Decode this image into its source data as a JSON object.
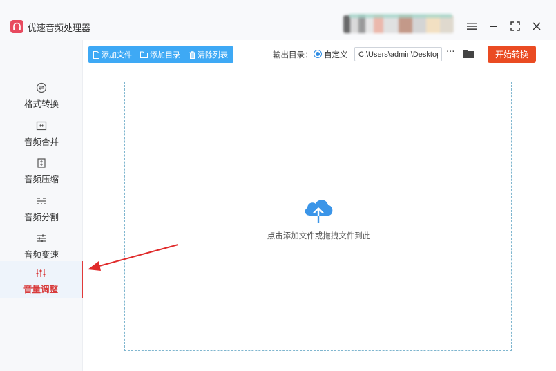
{
  "app": {
    "title": "优速音频处理器"
  },
  "window_controls": {
    "menu_icon": "hamburger-icon",
    "minimize_icon": "minimize-icon",
    "maximize_icon": "maximize-icon",
    "close_icon": "close-icon"
  },
  "sidebar": {
    "items": [
      {
        "label": "格式转换",
        "icon": "format-convert-icon",
        "active": false
      },
      {
        "label": "音频合并",
        "icon": "merge-icon",
        "active": false
      },
      {
        "label": "音频压缩",
        "icon": "compress-icon",
        "active": false
      },
      {
        "label": "音频分割",
        "icon": "split-icon",
        "active": false
      },
      {
        "label": "音频变速",
        "icon": "speed-icon",
        "active": false
      },
      {
        "label": "音量调整",
        "icon": "volume-adjust-icon",
        "active": true
      }
    ]
  },
  "toolbar": {
    "add_file": "添加文件",
    "add_folder": "添加目录",
    "clear_list": "清除列表"
  },
  "output": {
    "label": "输出目录：",
    "option": "自定义",
    "path": "C:\\Users\\admin\\Desktop",
    "more": "···"
  },
  "start_button": "开始转换",
  "dropzone": {
    "hint": "点击添加文件或拖拽文件到此",
    "icon": "cloud-upload-icon"
  },
  "colors": {
    "accent_blue": "#3ea9f5",
    "start_orange": "#ea4b22",
    "active_red": "#d83b3b",
    "annotation_red": "#e02a2a"
  }
}
